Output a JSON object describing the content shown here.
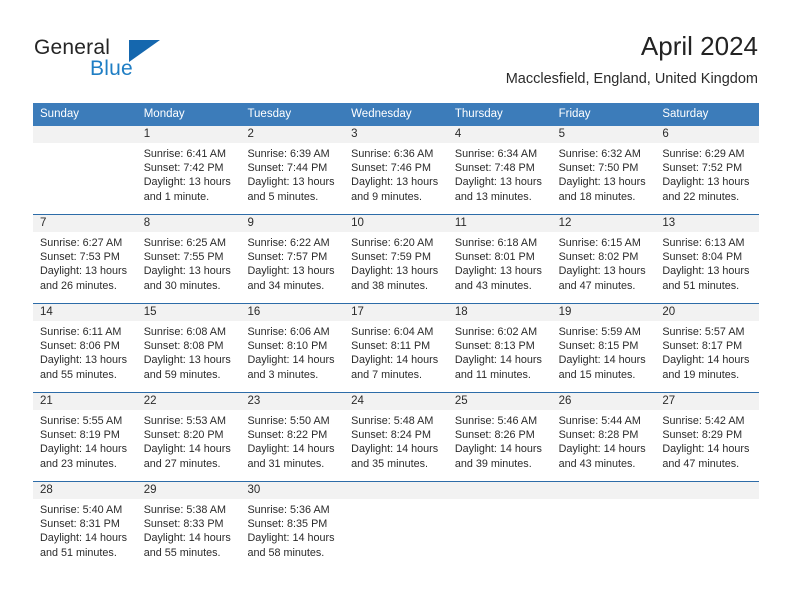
{
  "brand": {
    "name_part1": "General",
    "name_part2": "Blue",
    "triangle_color": "#1567ae",
    "blue_color": "#1f7ec4"
  },
  "header": {
    "title": "April 2024",
    "subtitle": "Macclesfield, England, United Kingdom"
  },
  "theme": {
    "header_row_bg": "#3c7cba",
    "row_divider": "#2d6ca8",
    "daynum_band_bg": "#f2f2f2",
    "text_color": "#2b2b2b"
  },
  "weekday_headers": [
    "Sunday",
    "Monday",
    "Tuesday",
    "Wednesday",
    "Thursday",
    "Friday",
    "Saturday"
  ],
  "weeks": [
    [
      {
        "day": "",
        "lines": [
          "",
          "",
          "",
          ""
        ]
      },
      {
        "day": "1",
        "lines": [
          "Sunrise: 6:41 AM",
          "Sunset: 7:42 PM",
          "Daylight: 13 hours",
          "and 1 minute."
        ]
      },
      {
        "day": "2",
        "lines": [
          "Sunrise: 6:39 AM",
          "Sunset: 7:44 PM",
          "Daylight: 13 hours",
          "and 5 minutes."
        ]
      },
      {
        "day": "3",
        "lines": [
          "Sunrise: 6:36 AM",
          "Sunset: 7:46 PM",
          "Daylight: 13 hours",
          "and 9 minutes."
        ]
      },
      {
        "day": "4",
        "lines": [
          "Sunrise: 6:34 AM",
          "Sunset: 7:48 PM",
          "Daylight: 13 hours",
          "and 13 minutes."
        ]
      },
      {
        "day": "5",
        "lines": [
          "Sunrise: 6:32 AM",
          "Sunset: 7:50 PM",
          "Daylight: 13 hours",
          "and 18 minutes."
        ]
      },
      {
        "day": "6",
        "lines": [
          "Sunrise: 6:29 AM",
          "Sunset: 7:52 PM",
          "Daylight: 13 hours",
          "and 22 minutes."
        ]
      }
    ],
    [
      {
        "day": "7",
        "lines": [
          "Sunrise: 6:27 AM",
          "Sunset: 7:53 PM",
          "Daylight: 13 hours",
          "and 26 minutes."
        ]
      },
      {
        "day": "8",
        "lines": [
          "Sunrise: 6:25 AM",
          "Sunset: 7:55 PM",
          "Daylight: 13 hours",
          "and 30 minutes."
        ]
      },
      {
        "day": "9",
        "lines": [
          "Sunrise: 6:22 AM",
          "Sunset: 7:57 PM",
          "Daylight: 13 hours",
          "and 34 minutes."
        ]
      },
      {
        "day": "10",
        "lines": [
          "Sunrise: 6:20 AM",
          "Sunset: 7:59 PM",
          "Daylight: 13 hours",
          "and 38 minutes."
        ]
      },
      {
        "day": "11",
        "lines": [
          "Sunrise: 6:18 AM",
          "Sunset: 8:01 PM",
          "Daylight: 13 hours",
          "and 43 minutes."
        ]
      },
      {
        "day": "12",
        "lines": [
          "Sunrise: 6:15 AM",
          "Sunset: 8:02 PM",
          "Daylight: 13 hours",
          "and 47 minutes."
        ]
      },
      {
        "day": "13",
        "lines": [
          "Sunrise: 6:13 AM",
          "Sunset: 8:04 PM",
          "Daylight: 13 hours",
          "and 51 minutes."
        ]
      }
    ],
    [
      {
        "day": "14",
        "lines": [
          "Sunrise: 6:11 AM",
          "Sunset: 8:06 PM",
          "Daylight: 13 hours",
          "and 55 minutes."
        ]
      },
      {
        "day": "15",
        "lines": [
          "Sunrise: 6:08 AM",
          "Sunset: 8:08 PM",
          "Daylight: 13 hours",
          "and 59 minutes."
        ]
      },
      {
        "day": "16",
        "lines": [
          "Sunrise: 6:06 AM",
          "Sunset: 8:10 PM",
          "Daylight: 14 hours",
          "and 3 minutes."
        ]
      },
      {
        "day": "17",
        "lines": [
          "Sunrise: 6:04 AM",
          "Sunset: 8:11 PM",
          "Daylight: 14 hours",
          "and 7 minutes."
        ]
      },
      {
        "day": "18",
        "lines": [
          "Sunrise: 6:02 AM",
          "Sunset: 8:13 PM",
          "Daylight: 14 hours",
          "and 11 minutes."
        ]
      },
      {
        "day": "19",
        "lines": [
          "Sunrise: 5:59 AM",
          "Sunset: 8:15 PM",
          "Daylight: 14 hours",
          "and 15 minutes."
        ]
      },
      {
        "day": "20",
        "lines": [
          "Sunrise: 5:57 AM",
          "Sunset: 8:17 PM",
          "Daylight: 14 hours",
          "and 19 minutes."
        ]
      }
    ],
    [
      {
        "day": "21",
        "lines": [
          "Sunrise: 5:55 AM",
          "Sunset: 8:19 PM",
          "Daylight: 14 hours",
          "and 23 minutes."
        ]
      },
      {
        "day": "22",
        "lines": [
          "Sunrise: 5:53 AM",
          "Sunset: 8:20 PM",
          "Daylight: 14 hours",
          "and 27 minutes."
        ]
      },
      {
        "day": "23",
        "lines": [
          "Sunrise: 5:50 AM",
          "Sunset: 8:22 PM",
          "Daylight: 14 hours",
          "and 31 minutes."
        ]
      },
      {
        "day": "24",
        "lines": [
          "Sunrise: 5:48 AM",
          "Sunset: 8:24 PM",
          "Daylight: 14 hours",
          "and 35 minutes."
        ]
      },
      {
        "day": "25",
        "lines": [
          "Sunrise: 5:46 AM",
          "Sunset: 8:26 PM",
          "Daylight: 14 hours",
          "and 39 minutes."
        ]
      },
      {
        "day": "26",
        "lines": [
          "Sunrise: 5:44 AM",
          "Sunset: 8:28 PM",
          "Daylight: 14 hours",
          "and 43 minutes."
        ]
      },
      {
        "day": "27",
        "lines": [
          "Sunrise: 5:42 AM",
          "Sunset: 8:29 PM",
          "Daylight: 14 hours",
          "and 47 minutes."
        ]
      }
    ],
    [
      {
        "day": "28",
        "lines": [
          "Sunrise: 5:40 AM",
          "Sunset: 8:31 PM",
          "Daylight: 14 hours",
          "and 51 minutes."
        ]
      },
      {
        "day": "29",
        "lines": [
          "Sunrise: 5:38 AM",
          "Sunset: 8:33 PM",
          "Daylight: 14 hours",
          "and 55 minutes."
        ]
      },
      {
        "day": "30",
        "lines": [
          "Sunrise: 5:36 AM",
          "Sunset: 8:35 PM",
          "Daylight: 14 hours",
          "and 58 minutes."
        ]
      },
      {
        "day": "",
        "lines": [
          "",
          "",
          "",
          ""
        ]
      },
      {
        "day": "",
        "lines": [
          "",
          "",
          "",
          ""
        ]
      },
      {
        "day": "",
        "lines": [
          "",
          "",
          "",
          ""
        ]
      },
      {
        "day": "",
        "lines": [
          "",
          "",
          "",
          ""
        ]
      }
    ]
  ]
}
